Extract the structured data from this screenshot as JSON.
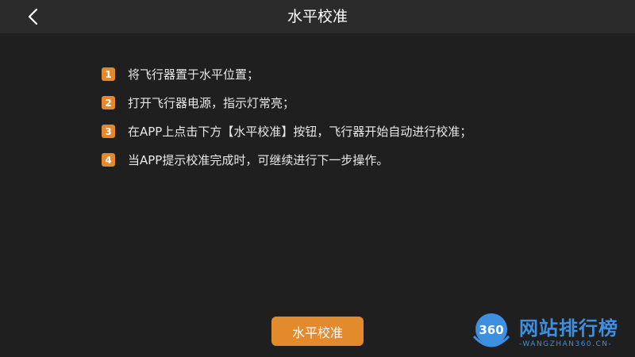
{
  "header": {
    "title": "水平校准",
    "back_icon": "chevron-left-icon"
  },
  "steps": [
    {
      "number": "1",
      "text": "将飞行器置于水平位置；"
    },
    {
      "number": "2",
      "text": "打开飞行器电源，指示灯常亮；"
    },
    {
      "number": "3",
      "text": "在APP上点击下方【水平校准】按钮，飞行器开始自动进行校准；"
    },
    {
      "number": "4",
      "text": "当APP提示校准完成时，可继续进行下一步操作。"
    }
  ],
  "action": {
    "button_label": "水平校准"
  },
  "watermark": {
    "logo_text": "360",
    "title": "网站排行榜",
    "subtitle": "-WANGZHAN360.CN-"
  },
  "colors": {
    "background": "#1f1f1f",
    "header": "#2b2b2b",
    "accent": "#e4882f",
    "watermark": "#3f8fe0"
  }
}
